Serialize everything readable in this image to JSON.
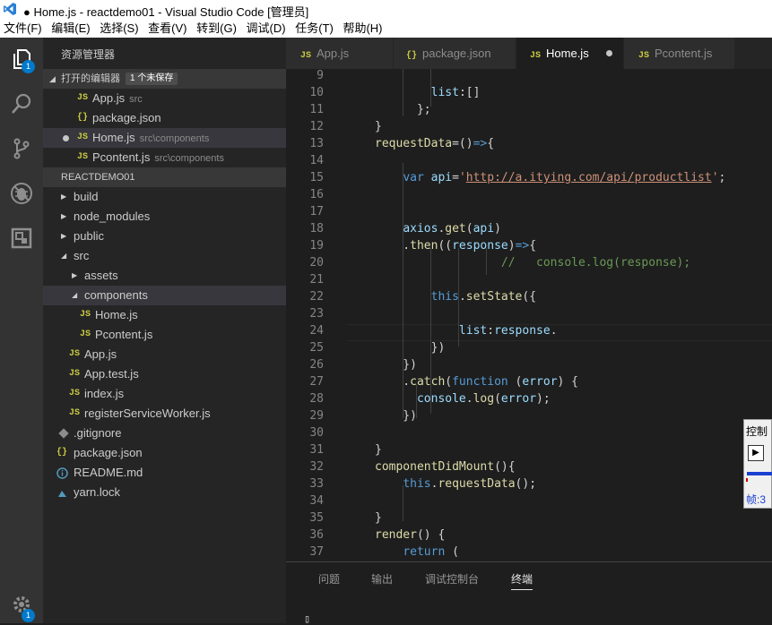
{
  "window": {
    "title": "● Home.js - reactdemo01 - Visual Studio Code [管理员]"
  },
  "menu": [
    "文件(F)",
    "编辑(E)",
    "选择(S)",
    "查看(V)",
    "转到(G)",
    "调试(D)",
    "任务(T)",
    "帮助(H)"
  ],
  "activity": {
    "explorer_badge": "1",
    "settings_badge": "1"
  },
  "sidebar": {
    "title": "资源管理器",
    "open_editors_label": "打开的编辑器",
    "unsaved_label": "1 个未保存",
    "open_editors": [
      {
        "name": "App.js",
        "path": "src",
        "icon": "JS"
      },
      {
        "name": "package.json",
        "path": "",
        "icon": "{}"
      },
      {
        "name": "Home.js",
        "path": "src\\components",
        "icon": "JS"
      },
      {
        "name": "Pcontent.js",
        "path": "src\\components",
        "icon": "JS"
      }
    ],
    "project_label": "REACTDEMO01",
    "tree": [
      {
        "name": "build",
        "type": "folder"
      },
      {
        "name": "node_modules",
        "type": "folder"
      },
      {
        "name": "public",
        "type": "folder"
      },
      {
        "name": "src",
        "type": "folder-open"
      },
      {
        "name": "assets",
        "type": "folder"
      },
      {
        "name": "components",
        "type": "folder-open"
      },
      {
        "name": "Home.js",
        "type": "js"
      },
      {
        "name": "Pcontent.js",
        "type": "js"
      },
      {
        "name": "App.js",
        "type": "js"
      },
      {
        "name": "App.test.js",
        "type": "js"
      },
      {
        "name": "index.js",
        "type": "js"
      },
      {
        "name": "registerServiceWorker.js",
        "type": "js"
      },
      {
        "name": ".gitignore",
        "type": "git"
      },
      {
        "name": "package.json",
        "type": "json"
      },
      {
        "name": "README.md",
        "type": "info"
      },
      {
        "name": "yarn.lock",
        "type": "yarn"
      }
    ]
  },
  "tabs": [
    {
      "label": "App.js",
      "icon": "JS"
    },
    {
      "label": "package.json",
      "icon": "{}"
    },
    {
      "label": "Home.js",
      "icon": "JS"
    },
    {
      "label": "Pcontent.js",
      "icon": "JS"
    }
  ],
  "editor": {
    "line_numbers": [
      "9",
      "10",
      "11",
      "12",
      "13",
      "14",
      "15",
      "16",
      "17",
      "18",
      "19",
      "20",
      "21",
      "22",
      "23",
      "24",
      "25",
      "26",
      "27",
      "28",
      "29",
      "30",
      "31",
      "32",
      "33",
      "34",
      "35",
      "36",
      "37"
    ]
  },
  "control": {
    "title": "控制",
    "frame_label": "帧:3"
  },
  "panel": {
    "tabs": [
      "问题",
      "输出",
      "调试控制台",
      "终端"
    ],
    "prompt": "▯"
  }
}
